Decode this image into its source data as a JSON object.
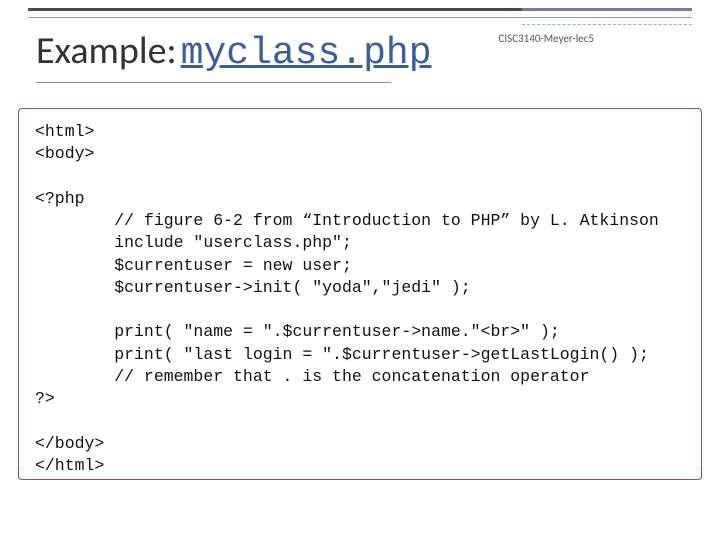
{
  "header": {
    "title_prefix": "Example:",
    "title_link": "myclass.php",
    "right_label": "CISC3140-Meyer-lec5"
  },
  "code": {
    "line01": "<html>",
    "line02": "<body>",
    "line03": "",
    "line04": "<?php",
    "line05": "        // figure 6-2 from “Introduction to PHP” by L. Atkinson",
    "line06": "        include \"userclass.php\";",
    "line07": "        $currentuser = new user;",
    "line08": "        $currentuser->init( \"yoda\",\"jedi\" );",
    "line09": "",
    "line10": "        print( \"name = \".$currentuser->name.\"<br>\" );",
    "line11": "        print( \"last login = \".$currentuser->getLastLogin() );",
    "line12": "        // remember that . is the concatenation operator",
    "line13": "?>",
    "line14": "",
    "line15": "</body>",
    "line16": "</html>"
  }
}
